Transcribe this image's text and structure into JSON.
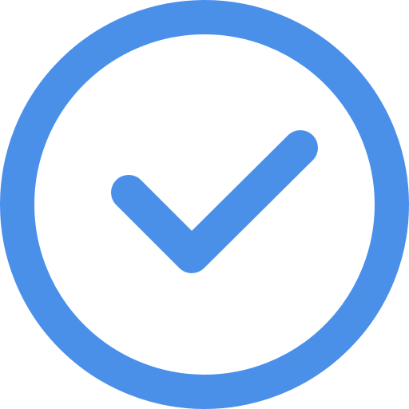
{
  "icon": {
    "name": "check-circle-icon",
    "color": "#4A90E9",
    "background": "#FFFFFF"
  }
}
